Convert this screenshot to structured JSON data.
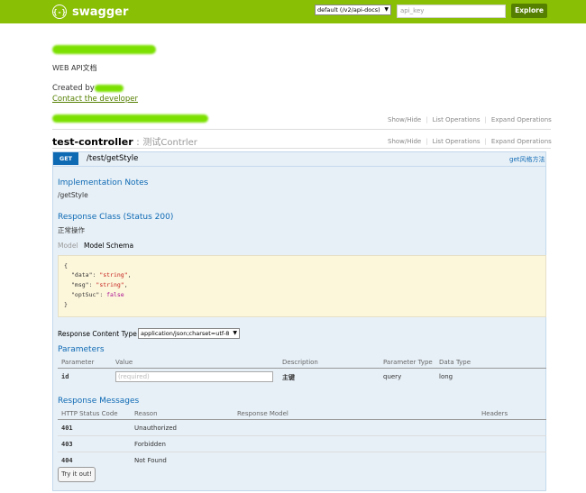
{
  "header": {
    "logo_glyph": "{-}",
    "logo_text": "swagger",
    "spec_select": "default (/v2/api-docs)",
    "api_key_placeholder": "api_key",
    "explore_label": "Explore",
    "bg_color": "#89bf04"
  },
  "info": {
    "description": "WEB API文档",
    "created_by": "Created by",
    "contact_link": "Contact the developer"
  },
  "top_links": [
    "Show/Hide",
    "List Operations",
    "Expand Operations"
  ],
  "resource": {
    "name": "test-controller",
    "separator": " : ",
    "desc": "测试Contrler",
    "links": [
      "Show/Hide",
      "List Operations",
      "Expand Operations"
    ]
  },
  "operation": {
    "method": "GET",
    "path": "/test/getStyle",
    "summary": "get风格方法",
    "impl_notes_title": "Implementation Notes",
    "impl_notes": "/getStyle",
    "response_class_title": "Response Class (Status 200)",
    "response_class_desc": "正常操作",
    "model_tab": "Model",
    "schema_tab": "Model Schema",
    "schema": {
      "open": "{",
      "lines": [
        {
          "key": "\"data\"",
          "val": "\"string\"",
          "type": "string",
          "comma": ","
        },
        {
          "key": "\"msg\"",
          "val": "\"string\"",
          "type": "string",
          "comma": ","
        },
        {
          "key": "\"optSuc\"",
          "val": "false",
          "type": "bool",
          "comma": ""
        }
      ],
      "close": "}"
    },
    "content_type_label": "Response Content Type",
    "content_type_value": "application/json;charset=utf-8",
    "parameters_title": "Parameters",
    "param_headers": [
      "Parameter",
      "Value",
      "Description",
      "Parameter Type",
      "Data Type"
    ],
    "params": [
      {
        "name": "id",
        "placeholder": "(required)",
        "description": "主键",
        "param_type": "query",
        "data_type": "long"
      }
    ],
    "response_messages_title": "Response Messages",
    "response_headers": [
      "HTTP Status Code",
      "Reason",
      "Response Model",
      "Headers"
    ],
    "responses": [
      {
        "code": "401",
        "reason": "Unauthorized"
      },
      {
        "code": "403",
        "reason": "Forbidden"
      },
      {
        "code": "404",
        "reason": "Not Found"
      }
    ],
    "try_label": "Try it out!"
  },
  "colors": {
    "get_blue": "#0f6ab4",
    "link_green": "#547f00",
    "op_bg": "#e7f0f7",
    "schema_bg": "#fcf6db"
  }
}
